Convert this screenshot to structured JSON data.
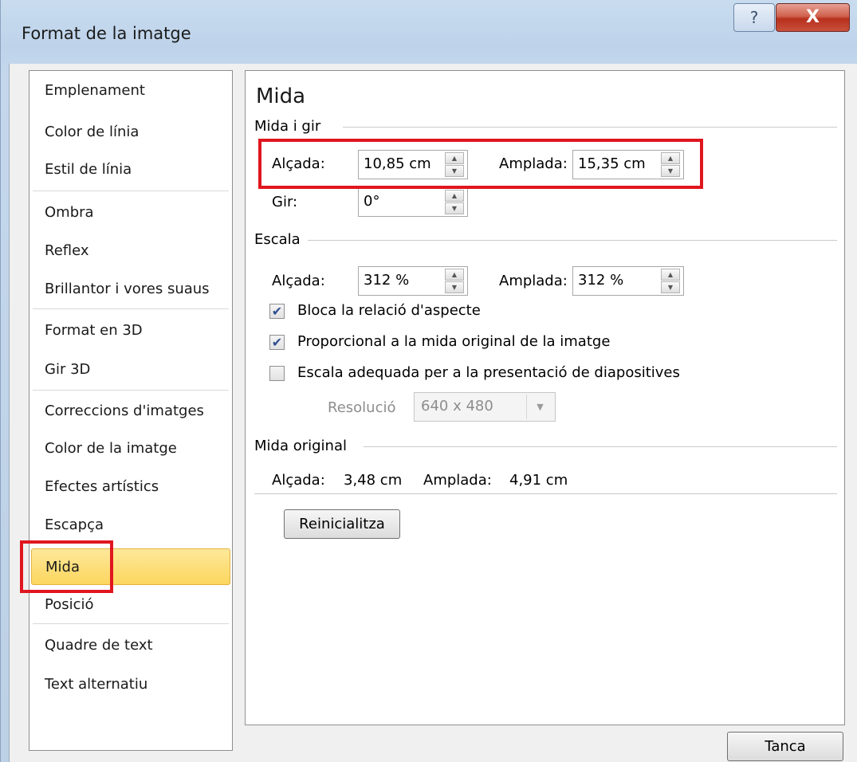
{
  "window": {
    "title": "Format de la imatge",
    "help_label": "?",
    "close_label": "X"
  },
  "nav": {
    "items": [
      {
        "label": "Emplenament"
      },
      {
        "label": "Color de línia"
      },
      {
        "label": "Estil de línia"
      },
      {
        "label": "Ombra"
      },
      {
        "label": "Reflex"
      },
      {
        "label": "Brillantor i vores suaus"
      },
      {
        "label": "Format en 3D"
      },
      {
        "label": "Gir 3D"
      },
      {
        "label": "Correccions d'imatges"
      },
      {
        "label": "Color de la imatge"
      },
      {
        "label": "Efectes artístics"
      },
      {
        "label": "Escapça"
      },
      {
        "label": "Mida",
        "selected": true
      },
      {
        "label": "Posició"
      },
      {
        "label": "Quadre de text"
      },
      {
        "label": "Text alternatiu"
      }
    ]
  },
  "pane": {
    "heading": "Mida",
    "size_rotate": {
      "label": "Mida i gir",
      "height_label": "Alçada:",
      "height_value": "10,85 cm",
      "width_label": "Amplada:",
      "width_value": "15,35 cm",
      "rotation_label": "Gir:",
      "rotation_value": "0°"
    },
    "scale": {
      "label": "Escala",
      "height_label": "Alçada:",
      "height_value": "312 %",
      "width_label": "Amplada:",
      "width_value": "312 %",
      "lock_aspect_label": "Bloca la relació d'aspecte",
      "lock_aspect_checked": true,
      "relative_label": "Proporcional a la mida original de la imatge",
      "relative_checked": true,
      "best_scale_label": "Escala adequada per a la presentació de diapositives",
      "best_scale_checked": false,
      "resolution_label": "Resolució",
      "resolution_value": "640 x 480"
    },
    "original": {
      "label": "Mida original",
      "height_label": "Alçada:",
      "height_value": "3,48 cm",
      "width_label": "Amplada:",
      "width_value": "4,91 cm"
    },
    "reset_label": "Reinicialitza"
  },
  "footer": {
    "close_label": "Tanca"
  },
  "colors": {
    "highlight": "#e0161f",
    "selection": "#fcd65e"
  },
  "icons": {
    "check": "✔",
    "spin_up": "▲",
    "spin_down": "▼",
    "dropdown": "▼"
  }
}
